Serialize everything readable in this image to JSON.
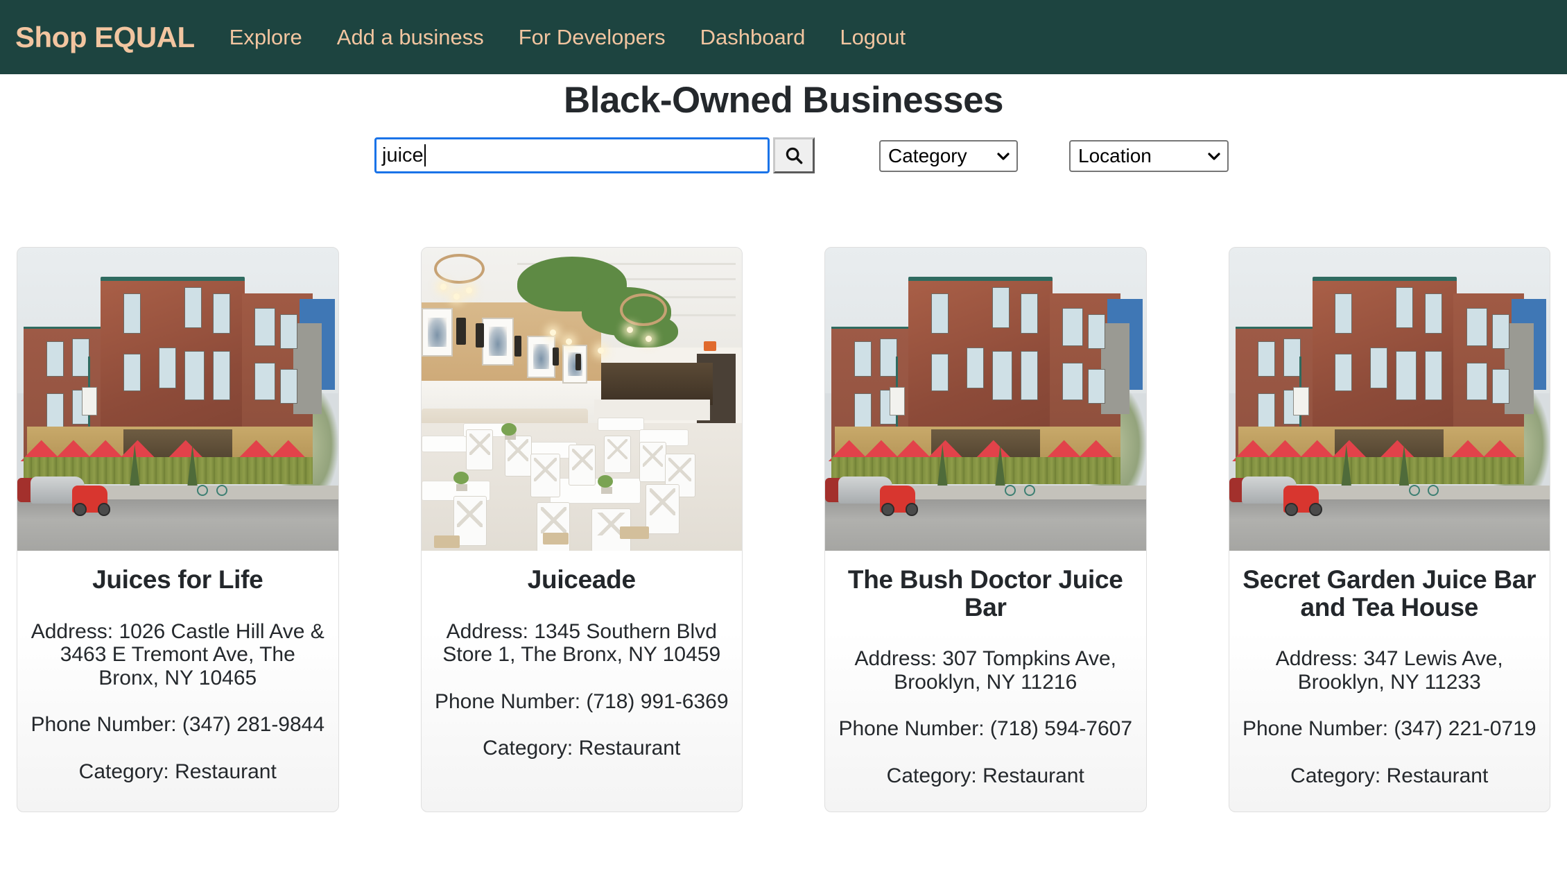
{
  "navbar": {
    "brand": "Shop EQUAL",
    "brand_color": "#f2c5a0",
    "background_color": "#1d4440",
    "links": [
      {
        "label": "Explore"
      },
      {
        "label": "Add a business"
      },
      {
        "label": "For Developers"
      },
      {
        "label": "Dashboard"
      },
      {
        "label": "Logout"
      }
    ]
  },
  "page": {
    "title": "Black-Owned Businesses"
  },
  "search": {
    "value": "juice",
    "placeholder": "",
    "button_icon": "search-icon",
    "focus_color": "#1a73e8",
    "filters": [
      {
        "name": "category",
        "selected": "Category"
      },
      {
        "name": "location",
        "selected": "Location"
      }
    ]
  },
  "results": [
    {
      "name": "Juices for Life",
      "address": "Address: 1026 Castle Hill Ave & 3463 E Tremont Ave, The Bronx, NY 10465",
      "phone": "Phone Number: (347) 281-9844",
      "category": "Category: Restaurant",
      "image": "street-corner-brick-building-photo"
    },
    {
      "name": "Juiceade",
      "address": "Address: 1345 Southern Blvd Store 1, The Bronx, NY 10459",
      "phone": "Phone Number: (718) 991-6369",
      "category": "Category: Restaurant",
      "image": "restaurant-interior-white-tables-photo"
    },
    {
      "name": "The Bush Doctor Juice Bar",
      "address": "Address: 307 Tompkins Ave, Brooklyn, NY 11216",
      "phone": "Phone Number: (718) 594-7607",
      "category": "Category: Restaurant",
      "image": "street-corner-brick-building-photo"
    },
    {
      "name": "Secret Garden Juice Bar and Tea House",
      "address": "Address: 347 Lewis Ave, Brooklyn, NY 11233",
      "phone": "Phone Number: (347) 221-0719",
      "category": "Category: Restaurant",
      "image": "street-corner-brick-building-photo"
    }
  ]
}
